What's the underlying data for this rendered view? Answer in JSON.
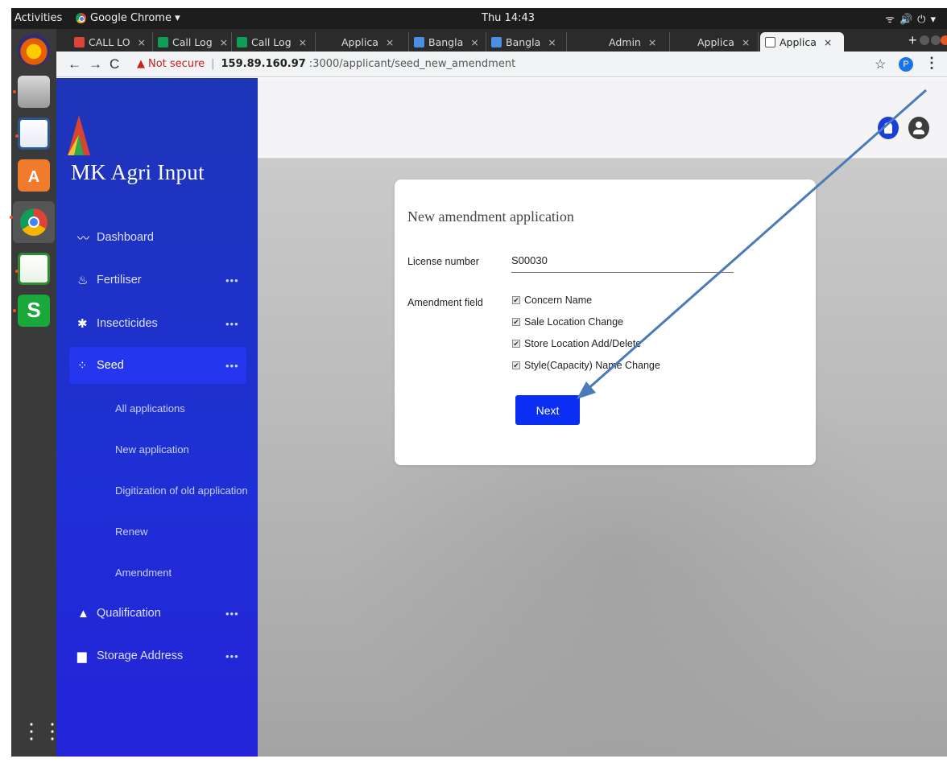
{
  "os": {
    "activities": "Activities",
    "app_name": "Google Chrome ▾",
    "clock": "Thu 14:43"
  },
  "browser": {
    "tabs": [
      {
        "label": "CALL LO",
        "icon_color": "#db4437"
      },
      {
        "label": "Call Log",
        "icon_color": "#0f9d58"
      },
      {
        "label": "Call Log",
        "icon_color": "#0f9d58"
      },
      {
        "label": "Applica",
        "icon_color": "#2b2b2b"
      },
      {
        "label": "Bangla",
        "icon_color": "#4a90e2"
      },
      {
        "label": "Bangla",
        "icon_color": "#4a90e2"
      },
      {
        "label": "Admin",
        "icon_color": "#2b2b2b"
      },
      {
        "label": "Applica",
        "icon_color": "#2b2b2b"
      },
      {
        "label": "Applica",
        "icon_color": "#ffffff"
      }
    ],
    "tab_close": "×",
    "new_tab": "+",
    "url": {
      "security_text": "Not secure",
      "host": "159.89.160.97",
      "path": ":3000/applicant/seed_new_amendment"
    },
    "profile_initial": "P"
  },
  "sidebar": {
    "brand": "MK Agri Input",
    "items": [
      {
        "label": "Dashboard",
        "icon": "chart-line-icon",
        "has_more": false
      },
      {
        "label": "Fertiliser",
        "icon": "flask-icon",
        "has_more": true
      },
      {
        "label": "Insecticides",
        "icon": "bug-icon",
        "has_more": true
      },
      {
        "label": "Seed",
        "icon": "seed-icon",
        "has_more": true,
        "active": true
      },
      {
        "label": "Qualification",
        "icon": "graduation-cap-icon",
        "has_more": true
      },
      {
        "label": "Storage Address",
        "icon": "warehouse-icon",
        "has_more": true
      }
    ],
    "more": "•••",
    "seed_subitems": [
      "All applications",
      "New application",
      "Digitization of old application",
      "Renew",
      "Amendment"
    ]
  },
  "form": {
    "title": "New amendment application",
    "license_label": "License number",
    "license_value": "S00030",
    "amendment_label": "Amendment field",
    "options": [
      {
        "label": "Concern Name",
        "checked": true
      },
      {
        "label": "Sale Location Change",
        "checked": true
      },
      {
        "label": "Store Location Add/Delete",
        "checked": true
      },
      {
        "label": "Style(Capacity) Name Change",
        "checked": true
      }
    ],
    "next_label": "Next"
  },
  "colors": {
    "sidebar": "#1f2fd6",
    "primary_button": "#0b2ff2",
    "annotation_arrow": "#4a7ab8"
  }
}
